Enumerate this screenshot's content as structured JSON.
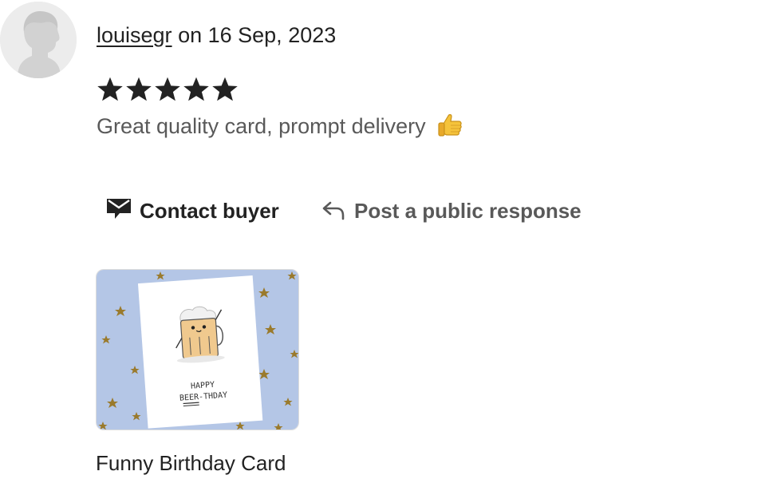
{
  "review": {
    "username": "louisegr",
    "date_text": "on 16 Sep, 2023",
    "rating": 5,
    "rating_max": 5,
    "text": "Great quality card, prompt delivery",
    "emoji_icon": "thumbs-up-icon"
  },
  "actions": {
    "contact_label": "Contact buyer",
    "contact_icon": "mail-icon",
    "respond_label": "Post a public response",
    "respond_icon": "reply-arrow-icon"
  },
  "listing": {
    "title": "Funny Birthday Card",
    "card_text_line1": "HAPPY",
    "card_text_line2": "BEER-THDAY"
  },
  "colors": {
    "text_primary": "#222222",
    "text_secondary": "#595959",
    "star": "#222222",
    "image_background": "#b4c6e6",
    "avatar_bg": "#ececec"
  }
}
